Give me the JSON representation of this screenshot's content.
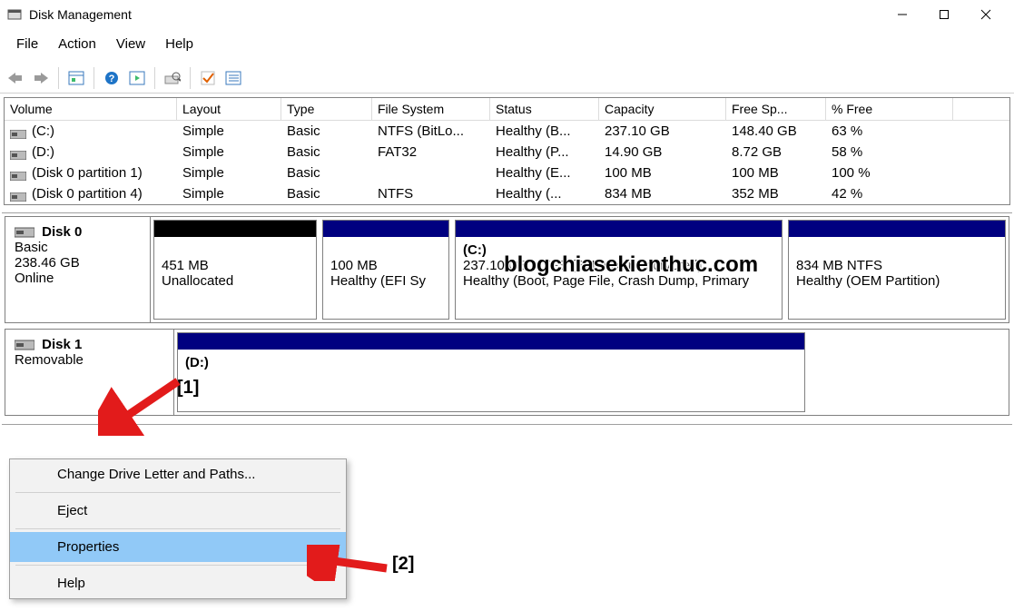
{
  "window": {
    "title": "Disk Management"
  },
  "menubar": {
    "file": "File",
    "action": "Action",
    "view": "View",
    "help": "Help"
  },
  "columns": {
    "volume": "Volume",
    "layout": "Layout",
    "type": "Type",
    "fs": "File System",
    "status": "Status",
    "capacity": "Capacity",
    "free": "Free Sp...",
    "pct": "% Free"
  },
  "volumes": [
    {
      "name": "(C:)",
      "layout": "Simple",
      "type": "Basic",
      "fs": "NTFS (BitLo...",
      "status": "Healthy (B...",
      "capacity": "237.10 GB",
      "free": "148.40 GB",
      "pct": "63 %"
    },
    {
      "name": "(D:)",
      "layout": "Simple",
      "type": "Basic",
      "fs": "FAT32",
      "status": "Healthy (P...",
      "capacity": "14.90 GB",
      "free": "8.72 GB",
      "pct": "58 %"
    },
    {
      "name": "(Disk 0 partition 1)",
      "layout": "Simple",
      "type": "Basic",
      "fs": "",
      "status": "Healthy (E...",
      "capacity": "100 MB",
      "free": "100 MB",
      "pct": "100 %"
    },
    {
      "name": "(Disk 0 partition 4)",
      "layout": "Simple",
      "type": "Basic",
      "fs": "NTFS",
      "status": "Healthy (...",
      "capacity": "834 MB",
      "free": "352 MB",
      "pct": "42 %"
    }
  ],
  "disk0": {
    "name": "Disk 0",
    "type": "Basic",
    "size": "238.46 GB",
    "status": "Online",
    "parts": [
      {
        "label": "",
        "size": "451 MB",
        "status": "Unallocated",
        "stripe": "black"
      },
      {
        "label": "",
        "size": "100 MB",
        "status": "Healthy (EFI Sy",
        "stripe": "navy"
      },
      {
        "label": "(C:)",
        "size": "237.10 GB NTFS (BitLocker Encrypted)",
        "status": "Healthy (Boot, Page File, Crash Dump, Primary",
        "stripe": "navy"
      },
      {
        "label": "",
        "size": "834 MB NTFS",
        "status": "Healthy (OEM Partition)",
        "stripe": "navy"
      }
    ]
  },
  "disk1": {
    "name": "Disk 1",
    "type": "Removable",
    "parts": [
      {
        "label": "(D:)",
        "stripe": "navy"
      }
    ]
  },
  "context_menu": {
    "change": "Change Drive Letter and Paths...",
    "eject": "Eject",
    "properties": "Properties",
    "help": "Help"
  },
  "annotations": {
    "one": "[1]",
    "two": "[2]",
    "watermark": "blogchiasekienthuc.com"
  }
}
